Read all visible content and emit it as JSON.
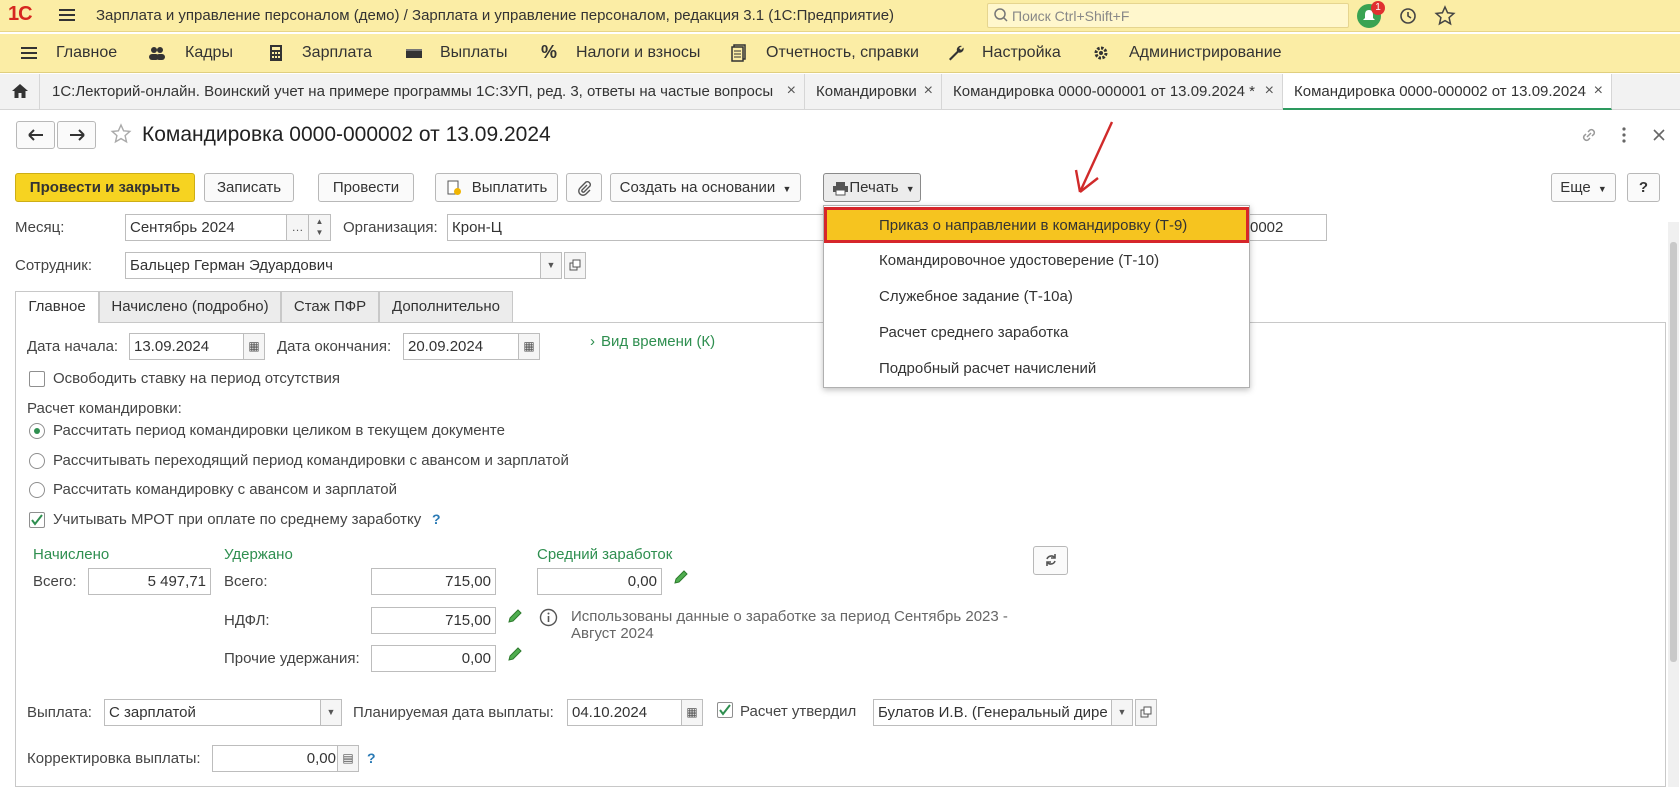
{
  "app": {
    "logo": "1С",
    "title": "Зарплата и управление персоналом (демо) / Зарплата и управление персоналом, редакция 3.1  (1С:Предприятие)",
    "search_placeholder": "Поиск Ctrl+Shift+F",
    "notification_count": "1"
  },
  "menu": [
    {
      "label": "Главное",
      "icon": "list-icon"
    },
    {
      "label": "Кадры",
      "icon": "people-icon"
    },
    {
      "label": "Зарплата",
      "icon": "calculator-icon"
    },
    {
      "label": "Выплаты",
      "icon": "wallet-icon"
    },
    {
      "label": "Налоги и взносы",
      "icon": "percent-icon"
    },
    {
      "label": "Отчетность, справки",
      "icon": "reports-icon"
    },
    {
      "label": "Настройка",
      "icon": "wrench-icon"
    },
    {
      "label": "Администрирование",
      "icon": "gear-icon"
    }
  ],
  "tabs": [
    {
      "label": "1С:Лекторий-онлайн. Воинский учет на примере программы 1С:ЗУП, ред. 3, ответы на частые вопросы",
      "close": "×"
    },
    {
      "label": "Командировки",
      "close": "×"
    },
    {
      "label": "Командировка 0000-000001 от 13.09.2024 *",
      "close": "×"
    },
    {
      "label": "Командировка 0000-000002 от 13.09.2024",
      "close": "×"
    }
  ],
  "form": {
    "title": "Командировка 0000-000002 от 13.09.2024",
    "toolbar": {
      "post_close": "Провести и закрыть",
      "save": "Записать",
      "post": "Провести",
      "pay": "Выплатить",
      "create_based": "Создать на основании",
      "print": "Печать",
      "more": "Еще",
      "help": "?"
    },
    "month_label": "Месяц:",
    "month_value": "Сентябрь 2024",
    "org_label": "Организация:",
    "org_value": "Крон-Ц",
    "number_value": "0002",
    "employee_label": "Сотрудник:",
    "employee_value": "Бальцер Герман Эдуардович",
    "tabs": [
      "Главное",
      "Начислено (подробно)",
      "Стаж ПФР",
      "Дополнительно"
    ],
    "start_label": "Дата начала:",
    "start_value": "13.09.2024",
    "end_label": "Дата окончания:",
    "end_value": "20.09.2024",
    "time_type": "Вид времени (К)",
    "free_rate": "Освободить ставку на период отсутствия",
    "calc_label": "Расчет командировки:",
    "radios": [
      "Рассчитать период командировки целиком в текущем документе",
      "Рассчитывать переходящий период командировки с авансом и зарплатой",
      "Рассчитать командировку с авансом и зарплатой"
    ],
    "mrot": "Учитывать МРОТ при оплате по среднему заработку",
    "question": "?",
    "accrued_title": "Начислено",
    "total_label": "Всего:",
    "accrued_total": "5 497,71",
    "withheld_title": "Удержано",
    "withheld_total": "715,00",
    "ndfl_label": "НДФЛ:",
    "ndfl_value": "715,00",
    "other_label": "Прочие удержания:",
    "other_value": "0,00",
    "avg_title": "Средний заработок",
    "avg_value": "0,00",
    "info_text_1": "Использованы данные о заработке за период Сентябрь 2023 -",
    "info_text_2": "Август 2024",
    "payout_label": "Выплата:",
    "payout_value": "С зарплатой",
    "planned_label": "Планируемая дата выплаты:",
    "planned_value": "04.10.2024",
    "approved_label": "Расчет утвердил",
    "approved_value": "Булатов И.В. (Генеральный дире",
    "correction_label": "Корректировка выплаты:",
    "correction_value": "0,00"
  },
  "print_menu": [
    "Приказ о направлении в командировку (Т-9)",
    "Командировочное удостоверение (Т-10)",
    "Служебное задание (Т-10а)",
    "Расчет среднего заработка",
    "Подробный расчет начислений"
  ],
  "colors": {
    "accent_yellow": "#f6d321",
    "highlight_red": "#d6262a",
    "green": "#2f8f50"
  }
}
